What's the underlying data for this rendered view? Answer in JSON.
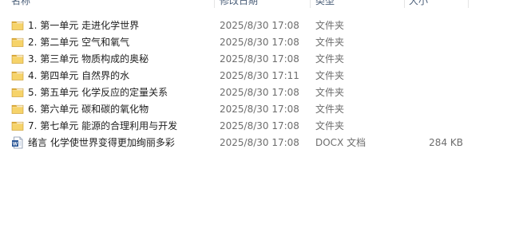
{
  "columns": {
    "name": "名称",
    "date": "修改日期",
    "type": "类型",
    "size": "大小"
  },
  "files": [
    {
      "name": "1. 第一单元 走进化学世界",
      "date": "2025/8/30 17:08",
      "type": "文件夹",
      "size": "",
      "icon": "folder-icon"
    },
    {
      "name": "2. 第二单元 空气和氧气",
      "date": "2025/8/30 17:08",
      "type": "文件夹",
      "size": "",
      "icon": "folder-icon"
    },
    {
      "name": "3. 第三单元 物质构成的奥秘",
      "date": "2025/8/30 17:08",
      "type": "文件夹",
      "size": "",
      "icon": "folder-icon"
    },
    {
      "name": "4. 第四单元 自然界的水",
      "date": "2025/8/30 17:11",
      "type": "文件夹",
      "size": "",
      "icon": "folder-icon"
    },
    {
      "name": "5. 第五单元 化学反应的定量关系",
      "date": "2025/8/30 17:08",
      "type": "文件夹",
      "size": "",
      "icon": "folder-icon"
    },
    {
      "name": "6. 第六单元 碳和碳的氧化物",
      "date": "2025/8/30 17:08",
      "type": "文件夹",
      "size": "",
      "icon": "folder-icon"
    },
    {
      "name": "7. 第七单元 能源的合理利用与开发",
      "date": "2025/8/30 17:08",
      "type": "文件夹",
      "size": "",
      "icon": "folder-icon"
    },
    {
      "name": "绪言 化学使世界变得更加绚丽多彩",
      "date": "2025/8/30 17:08",
      "type": "DOCX 文档",
      "size": "284 KB",
      "icon": "word-document-icon"
    }
  ]
}
